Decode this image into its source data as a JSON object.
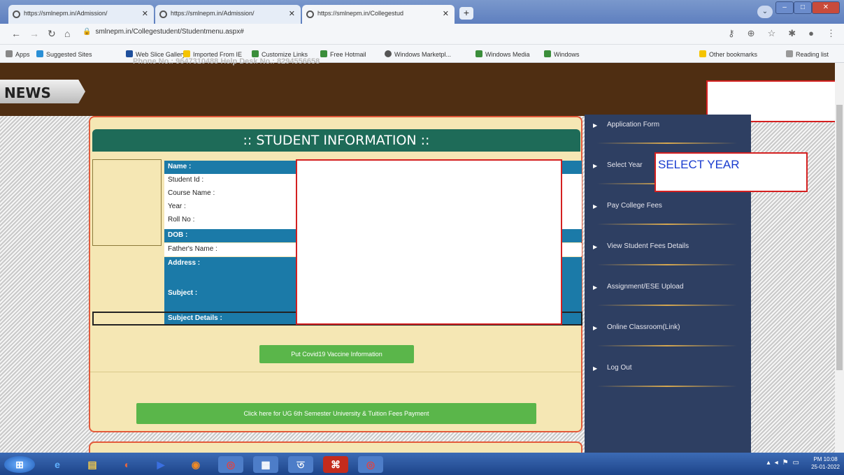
{
  "browser": {
    "tabs": [
      {
        "title": "https://smlnepm.in/Admission/"
      },
      {
        "title": "https://smlnepm.in/Admission/"
      },
      {
        "title": "https://smlnepm.in/Collegestud"
      }
    ],
    "url": "smlnepm.in/Collegestudent/Studentmenu.aspx#",
    "bookmarks": [
      "Apps",
      "Suggested Sites",
      "Web Slice Gallery",
      "Imported From IE",
      "Customize Links",
      "Free Hotmail",
      "Windows Marketpl...",
      "Windows Media",
      "Windows",
      "Other bookmarks",
      "Reading list"
    ]
  },
  "site": {
    "news_label": "NEWS",
    "header_contact": "Phone No.: 9647310488    Help Desk No.: 8294556658",
    "info_title": ":: STUDENT INFORMATION ::",
    "fields": {
      "name": "Name :",
      "student_id": "Student Id :",
      "course_name": "Course Name :",
      "year": "Year :",
      "roll_no": "Roll No :",
      "dob": "DOB :",
      "fathers_name": "Father's Name :",
      "address": "Address :",
      "subject": "Subject :",
      "subject_details": "Subject Details :"
    },
    "covid_button": "Put Covid19 Vaccine Information",
    "fees_button": "Click here for UG 6th Semester University & Tuition Fees Payment"
  },
  "menu": {
    "items": [
      {
        "label": "Application Form"
      },
      {
        "label": "Select Year"
      },
      {
        "label": "Pay College Fees"
      },
      {
        "label": "View Student Fees Details"
      },
      {
        "label": "Assignment/ESE Upload"
      },
      {
        "label": "Online Classroom(Link)"
      },
      {
        "label": "Log Out"
      }
    ]
  },
  "annotation": {
    "select_year": "SELECT YEAR"
  },
  "taskbar": {
    "time": "PM 10:08",
    "date": "25-01-2022"
  },
  "colors": {
    "accent_green": "#1e6b58",
    "row_blue": "#1b7aa8",
    "menu_bg": "#2e3f62",
    "button_green": "#5ab64a",
    "redaction_border": "#d42020"
  }
}
